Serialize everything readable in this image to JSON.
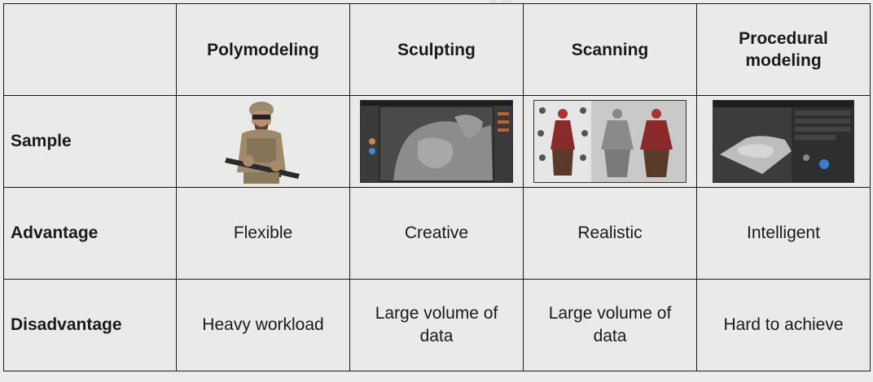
{
  "columns": [
    "Polymodeling",
    "Sculpting",
    "Scanning",
    "Procedural modeling"
  ],
  "rows": [
    {
      "label": "Sample"
    },
    {
      "label": "Advantage",
      "values": [
        "Flexible",
        "Creative",
        "Realistic",
        "Intelligent"
      ]
    },
    {
      "label": "Disadvantage",
      "values": [
        "Heavy workload",
        "Large volume of data",
        "Large volume of data",
        "Hard to achieve"
      ]
    }
  ],
  "samples": [
    "soldier-character-image",
    "sculpting-software-screenshot",
    "scanned-character-image",
    "procedural-terrain-screenshot"
  ],
  "watermark": "GAMES104"
}
